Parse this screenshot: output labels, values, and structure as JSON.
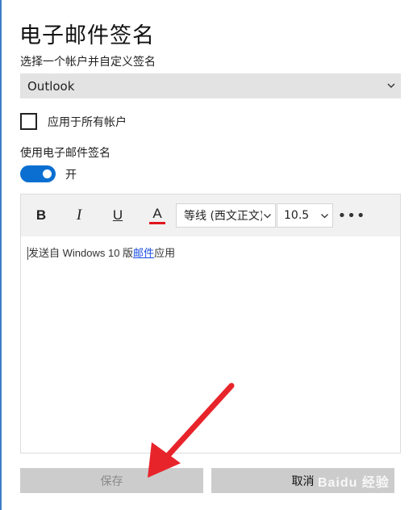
{
  "title": "电子邮件签名",
  "account_prompt": "选择一个帐户并自定义签名",
  "account_select": {
    "value": "Outlook",
    "icon": "chevron-down-icon"
  },
  "apply_all": {
    "label": "应用于所有帐户",
    "checked": false
  },
  "signature_toggle": {
    "label": "使用电子邮件签名",
    "state_label": "开",
    "on": true,
    "color": "#0a6fd1"
  },
  "toolbar": {
    "bold": "B",
    "italic": "I",
    "underline": "U",
    "font_color": "A",
    "font_color_value": "#e0161c",
    "font_family": "等线 (西文正文)",
    "font_size": "10.5",
    "more": "•••"
  },
  "editor": {
    "text_before": "发送自 Windows 10 版",
    "link_text": "邮件",
    "text_after": "应用"
  },
  "buttons": {
    "save": "保存",
    "cancel": "取消"
  },
  "watermark": "Baidu 经验"
}
